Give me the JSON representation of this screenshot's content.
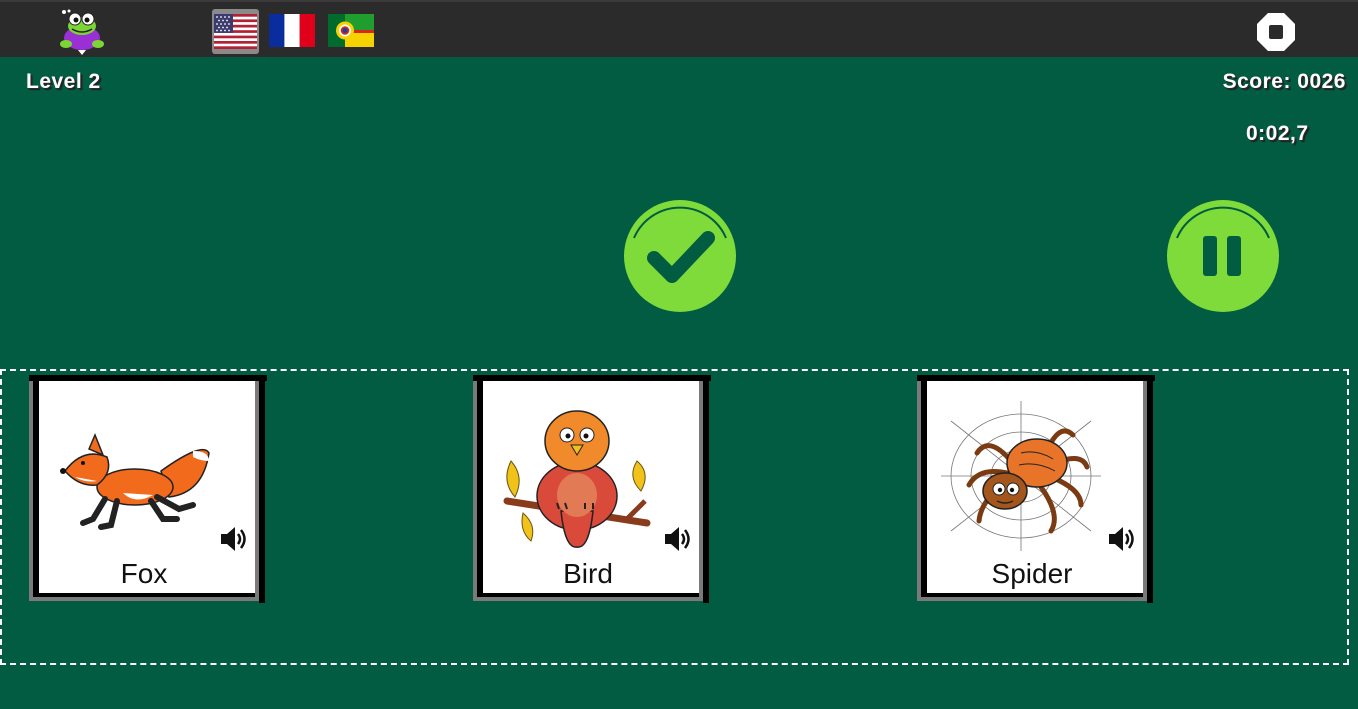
{
  "header": {
    "logo_icon": "frog-mascot-icon",
    "languages": [
      {
        "code": "en-US",
        "icon": "us-flag-icon",
        "selected": true
      },
      {
        "code": "fr",
        "icon": "france-flag-icon",
        "selected": false
      },
      {
        "code": "pt-BR",
        "icon": "brazil-flag-icon",
        "selected": false
      }
    ],
    "stop_icon": "stop-icon"
  },
  "status": {
    "level_text": "Level  2",
    "score_text": "Score:  0026",
    "timer_text": "0:02,7"
  },
  "controls": {
    "check_icon": "checkmark-icon",
    "pause_icon": "pause-icon",
    "button_color": "#7edb3a"
  },
  "cards": [
    {
      "label": "Fox",
      "image_icon": "fox-illustration",
      "audio_icon": "speaker-icon"
    },
    {
      "label": "Bird",
      "image_icon": "bird-illustration",
      "audio_icon": "speaker-icon"
    },
    {
      "label": "Spider",
      "image_icon": "spider-illustration",
      "audio_icon": "speaker-icon"
    }
  ],
  "colors": {
    "background": "#025c42",
    "topbar": "#2b2b2b",
    "accent_green": "#7edb3a"
  }
}
